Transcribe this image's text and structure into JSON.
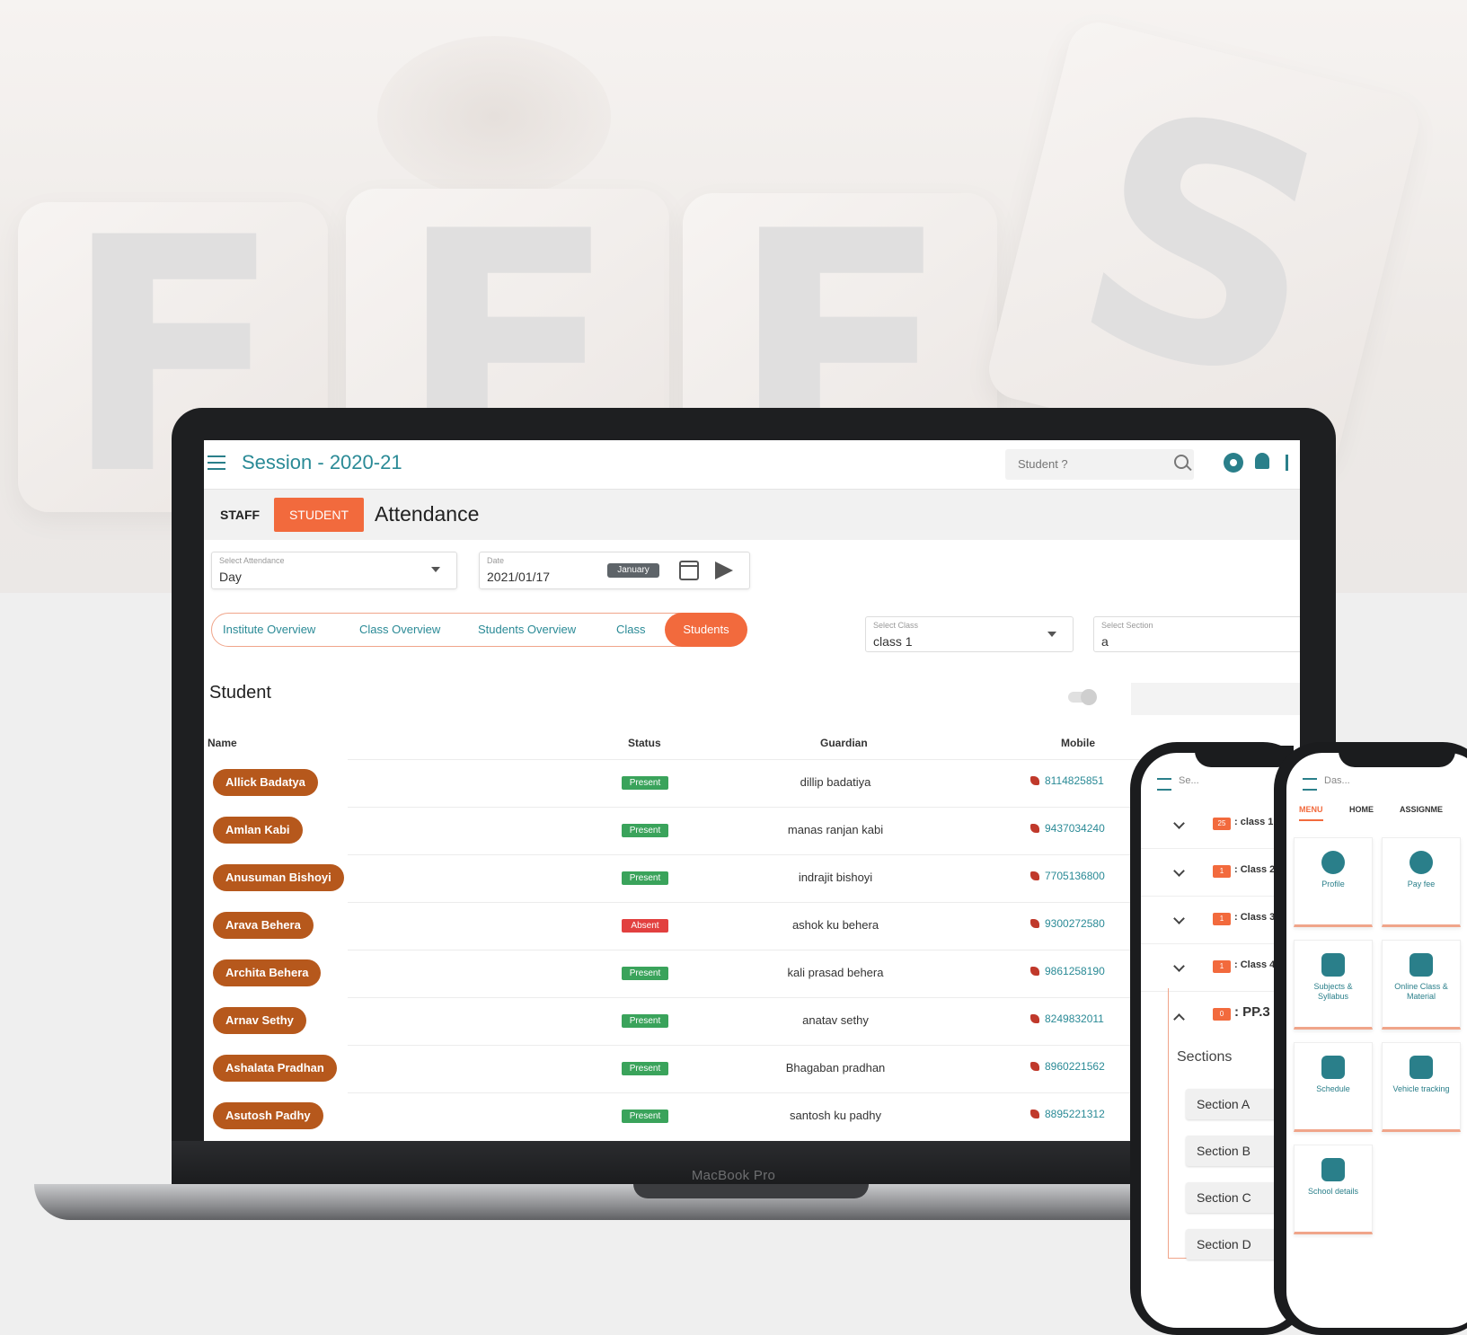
{
  "background": {
    "letters": [
      "F",
      "E",
      "E",
      "S"
    ]
  },
  "laptop": {
    "brand_label": "MacBook Pro",
    "app": {
      "session_title": "Session - 2020-21",
      "search_placeholder": "Student ?",
      "tabs": {
        "staff": "STAFF",
        "student": "STUDENT"
      },
      "page_title": "Attendance",
      "attendance_select": {
        "label": "Select Attendance",
        "value": "Day"
      },
      "date_select": {
        "label": "Date",
        "value": "2021/01/17",
        "month": "January"
      },
      "overview_tabs": [
        "Institute Overview",
        "Class Overview",
        "Students Overview",
        "Class",
        "Students"
      ],
      "class_select": {
        "label": "Select Class",
        "value": "class 1"
      },
      "section_select": {
        "label": "Select Section",
        "value": "a"
      },
      "section_title": "Student",
      "columns": {
        "name": "Name",
        "status": "Status",
        "guardian": "Guardian",
        "mobile": "Mobile"
      },
      "status_colors": {
        "Present": "#3aa35b",
        "Absent": "#e2403f"
      },
      "rows": [
        {
          "name": "Allick Badatya",
          "status": "Present",
          "guardian": "dillip badatiya",
          "mobile": "8114825851"
        },
        {
          "name": "Amlan Kabi",
          "status": "Present",
          "guardian": "manas ranjan kabi",
          "mobile": "9437034240"
        },
        {
          "name": "Anusuman Bishoyi",
          "status": "Present",
          "guardian": "indrajit bishoyi",
          "mobile": "7705136800"
        },
        {
          "name": "Arava Behera",
          "status": "Absent",
          "guardian": "ashok ku behera",
          "mobile": "9300272580"
        },
        {
          "name": "Archita Behera",
          "status": "Present",
          "guardian": "kali prasad behera",
          "mobile": "9861258190"
        },
        {
          "name": "Arnav Sethy",
          "status": "Present",
          "guardian": "anatav sethy",
          "mobile": "8249832011"
        },
        {
          "name": "Ashalata Pradhan",
          "status": "Present",
          "guardian": "Bhagaban pradhan",
          "mobile": "8960221562"
        },
        {
          "name": "Asutosh Padhy",
          "status": "Present",
          "guardian": "santosh ku padhy",
          "mobile": "8895221312"
        }
      ]
    }
  },
  "phone1": {
    "header_label": "Se...",
    "classes": [
      {
        "badge": "25",
        "label": ": class 1"
      },
      {
        "badge": "1",
        "label": ": Class 2"
      },
      {
        "badge": "1",
        "label": ": Class 3"
      },
      {
        "badge": "1",
        "label": ": Class 4"
      },
      {
        "badge": "0",
        "label": ": PP.3"
      }
    ],
    "sections_title": "Sections",
    "sections": [
      "Section A",
      "Section B",
      "Section C",
      "Section D"
    ]
  },
  "phone2": {
    "header_label": "Das...",
    "tabs": [
      "MENU",
      "HOME",
      "ASSIGNME"
    ],
    "tiles": [
      "Profile",
      "Pay fee",
      "Subjects & Syllabus",
      "Online Class & Material",
      "Schedule",
      "Vehicle tracking",
      "School details"
    ]
  },
  "accent_colors": {
    "teal": "#2a8a96",
    "orange": "#f26a3d",
    "pill_brown": "#b6581c"
  }
}
